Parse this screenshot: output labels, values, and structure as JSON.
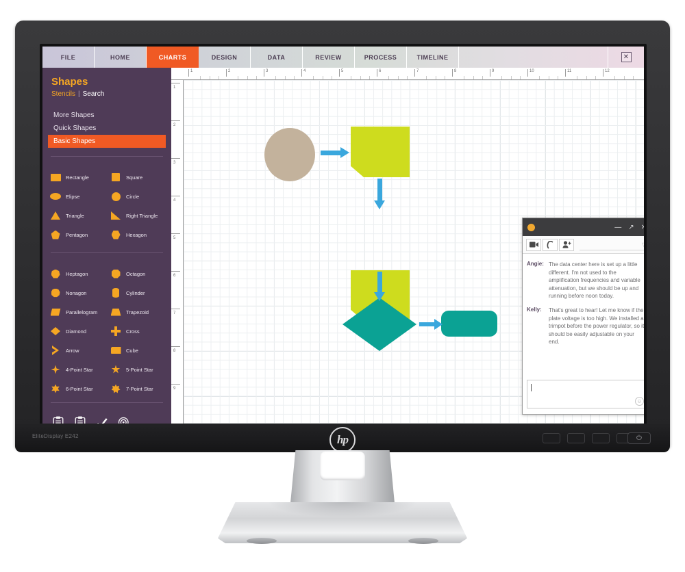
{
  "monitor": {
    "model_label": "EliteDisplay E242",
    "brand": "hp",
    "power_icon": "power-icon",
    "osd_button_count": 4
  },
  "app": {
    "close_label": "✕",
    "tabs": [
      {
        "label": "FILE",
        "active": false
      },
      {
        "label": "HOME",
        "active": false
      },
      {
        "label": "CHARTS",
        "active": true
      },
      {
        "label": "DESIGN",
        "active": false
      },
      {
        "label": "DATA",
        "active": false
      },
      {
        "label": "REVIEW",
        "active": false
      },
      {
        "label": "PROCESS",
        "active": false
      },
      {
        "label": "TIMELINE",
        "active": false
      }
    ]
  },
  "sidebar": {
    "title": "Shapes",
    "links": {
      "stencils": "Stencils",
      "separator": "|",
      "search": "Search"
    },
    "nav": [
      {
        "label": "More Shapes",
        "active": false
      },
      {
        "label": "Quick Shapes",
        "active": false
      },
      {
        "label": "Basic Shapes",
        "active": true
      }
    ],
    "shapes_group_1": [
      {
        "label": "Rectangle",
        "icon": "rectangle-icon"
      },
      {
        "label": "Square",
        "icon": "square-icon"
      },
      {
        "label": "Elipse",
        "icon": "ellipse-icon"
      },
      {
        "label": "Circle",
        "icon": "circle-icon"
      },
      {
        "label": "Triangle",
        "icon": "triangle-icon"
      },
      {
        "label": "Right Triangle",
        "icon": "right-triangle-icon"
      },
      {
        "label": "Pentagon",
        "icon": "pentagon-icon"
      },
      {
        "label": "Hexagon",
        "icon": "hexagon-icon"
      }
    ],
    "shapes_group_2": [
      {
        "label": "Heptagon",
        "icon": "heptagon-icon"
      },
      {
        "label": "Octagon",
        "icon": "octagon-icon"
      },
      {
        "label": "Nonagon",
        "icon": "nonagon-icon"
      },
      {
        "label": "Cylinder",
        "icon": "cylinder-icon"
      },
      {
        "label": "Parallelogram",
        "icon": "parallelogram-icon"
      },
      {
        "label": "Trapezoid",
        "icon": "trapezoid-icon"
      },
      {
        "label": "Diamond",
        "icon": "diamond-icon"
      },
      {
        "label": "Cross",
        "icon": "cross-icon"
      },
      {
        "label": "Arrow",
        "icon": "arrow-icon"
      },
      {
        "label": "Cube",
        "icon": "cube-icon"
      },
      {
        "label": "4-Point Star",
        "icon": "star-4-icon"
      },
      {
        "label": "5-Point Star",
        "icon": "star-5-icon"
      },
      {
        "label": "6-Point Star",
        "icon": "star-6-icon"
      },
      {
        "label": "7-Point Star",
        "icon": "star-7-icon"
      }
    ],
    "tools": [
      {
        "icon": "clipboard-check-icon"
      },
      {
        "icon": "clipboard-list-icon"
      },
      {
        "icon": "checkmark-icon"
      },
      {
        "icon": "target-icon"
      }
    ],
    "colors": {
      "background": "#4f3b57",
      "accent": "#f05a24",
      "title": "#f5a623",
      "shape_icon": "#f5a623"
    }
  },
  "canvas": {
    "ruler_h": [
      "1",
      "2",
      "3",
      "4",
      "5",
      "6",
      "7",
      "8",
      "9",
      "10",
      "11",
      "12"
    ],
    "ruler_v": [
      "1",
      "2",
      "3",
      "4",
      "5",
      "6",
      "7",
      "8",
      "9"
    ],
    "nodes": [
      {
        "name": "start-ellipse",
        "shape": "ellipse",
        "color": "#c3b29c",
        "label": ""
      },
      {
        "name": "note-1",
        "shape": "folded-note",
        "color": "#cedc1e",
        "label": ""
      },
      {
        "name": "note-2",
        "shape": "folded-note",
        "color": "#cedc1e",
        "label": ""
      },
      {
        "name": "decision-diamond",
        "shape": "diamond",
        "color": "#0ba294",
        "label": ""
      },
      {
        "name": "end-rounded-rect",
        "shape": "rounded-rect",
        "color": "#0ba294",
        "label": ""
      }
    ],
    "connector_color": "#3aa7dd"
  },
  "chat": {
    "titlebar": {
      "avatar": "user-avatar",
      "minimize": "—",
      "maximize": "↗",
      "close": "✕"
    },
    "toolbar": [
      {
        "icon": "video-call-icon",
        "label": "▬"
      },
      {
        "icon": "phone-call-icon",
        "label": "☎"
      },
      {
        "icon": "add-person-icon",
        "label": "☺"
      }
    ],
    "filter_caret": "▽",
    "messages": [
      {
        "sender": "Angie:",
        "text": "The data center here is set up a little different. I'm not used to the amplification frequencies and variable attenuation, but we should be up and running before noon today."
      },
      {
        "sender": "Kelly:",
        "text": "That's great to hear! Let me know if the plate voltage is too high. We installed a trimpot before the power regulator, so it should be easily adjustable on your end."
      }
    ],
    "input": {
      "value": "",
      "placeholder": ""
    },
    "emoji_icon": "☺"
  }
}
